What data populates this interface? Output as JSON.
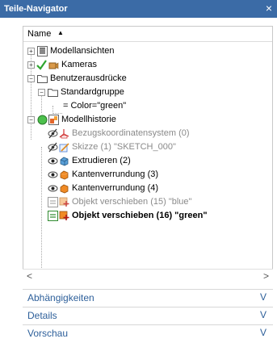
{
  "window": {
    "title": "Teile-Navigator",
    "close_glyph": "×"
  },
  "column_header": {
    "label": "Name",
    "sort_glyph": "▲"
  },
  "tree": [
    {
      "label": "Modellansichten",
      "expander": "+"
    },
    {
      "label": "Kameras",
      "expander": "+"
    },
    {
      "label": "Benutzerausdrücke",
      "expander": "−"
    },
    {
      "label": "Standardgruppe",
      "expander": "−"
    },
    {
      "label": "= Color=\"green\""
    },
    {
      "label": "Modellhistorie",
      "expander": "−"
    },
    {
      "label": "Bezugskoordinatensystem (0)"
    },
    {
      "label": "Skizze (1) \"SKETCH_000\""
    },
    {
      "label": "Extrudieren (2)"
    },
    {
      "label": "Kantenverrundung (3)"
    },
    {
      "label": "Kantenverrundung (4)"
    },
    {
      "label": "Objekt verschieben (15) \"blue\""
    },
    {
      "label": "Objekt verschieben (16) \"green\""
    }
  ],
  "scroll": {
    "left": "<",
    "right": ">"
  },
  "panels": [
    {
      "label": "Abhängigkeiten",
      "chevron": "V"
    },
    {
      "label": "Details",
      "chevron": "V"
    },
    {
      "label": "Vorschau",
      "chevron": "V"
    }
  ]
}
